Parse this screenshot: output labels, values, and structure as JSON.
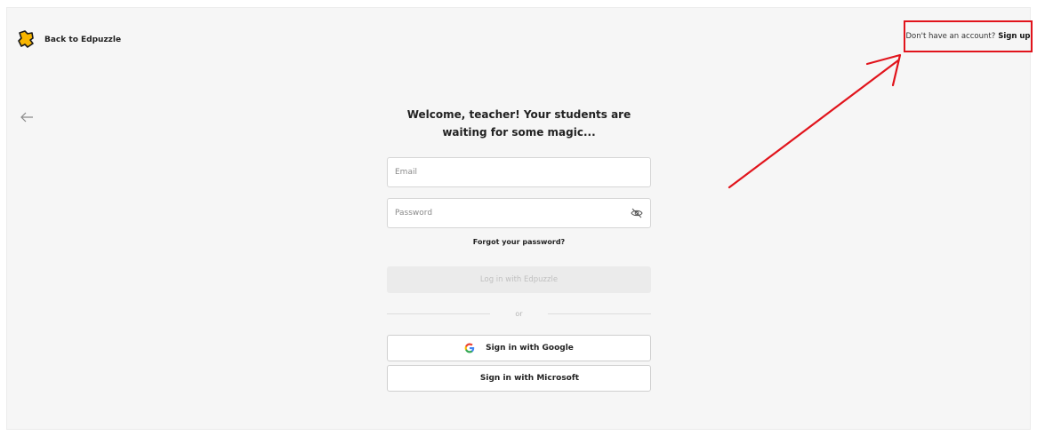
{
  "header": {
    "back_label": "Back to Edpuzzle",
    "signup_prompt": "Don't have an account?",
    "signup_link": "Sign up"
  },
  "login": {
    "heading": "Welcome, teacher! Your students are waiting for some magic...",
    "email_placeholder": "Email",
    "password_placeholder": "Password",
    "forgot_label": "Forgot your password?",
    "login_button": "Log in with Edpuzzle",
    "divider_label": "or",
    "google_button": "Sign in with Google",
    "microsoft_button": "Sign in with Microsoft"
  },
  "icons": {
    "logo": "edpuzzle-puzzle-logo",
    "back": "arrow-left-icon",
    "eye": "eye-slash-icon",
    "google": "google-g-icon",
    "microsoft": "microsoft-squares-icon"
  },
  "colors": {
    "brand_yellow": "#f7b500",
    "annotation_red": "#e1141c",
    "disabled_button": "#ebebeb",
    "google_blue": "#4285F4",
    "google_red": "#EA4335",
    "google_yellow": "#FBBC05",
    "google_green": "#34A853",
    "ms_red": "#F25022",
    "ms_green": "#7FBA00",
    "ms_blue": "#00A4EF",
    "ms_yellow": "#FFB900"
  }
}
